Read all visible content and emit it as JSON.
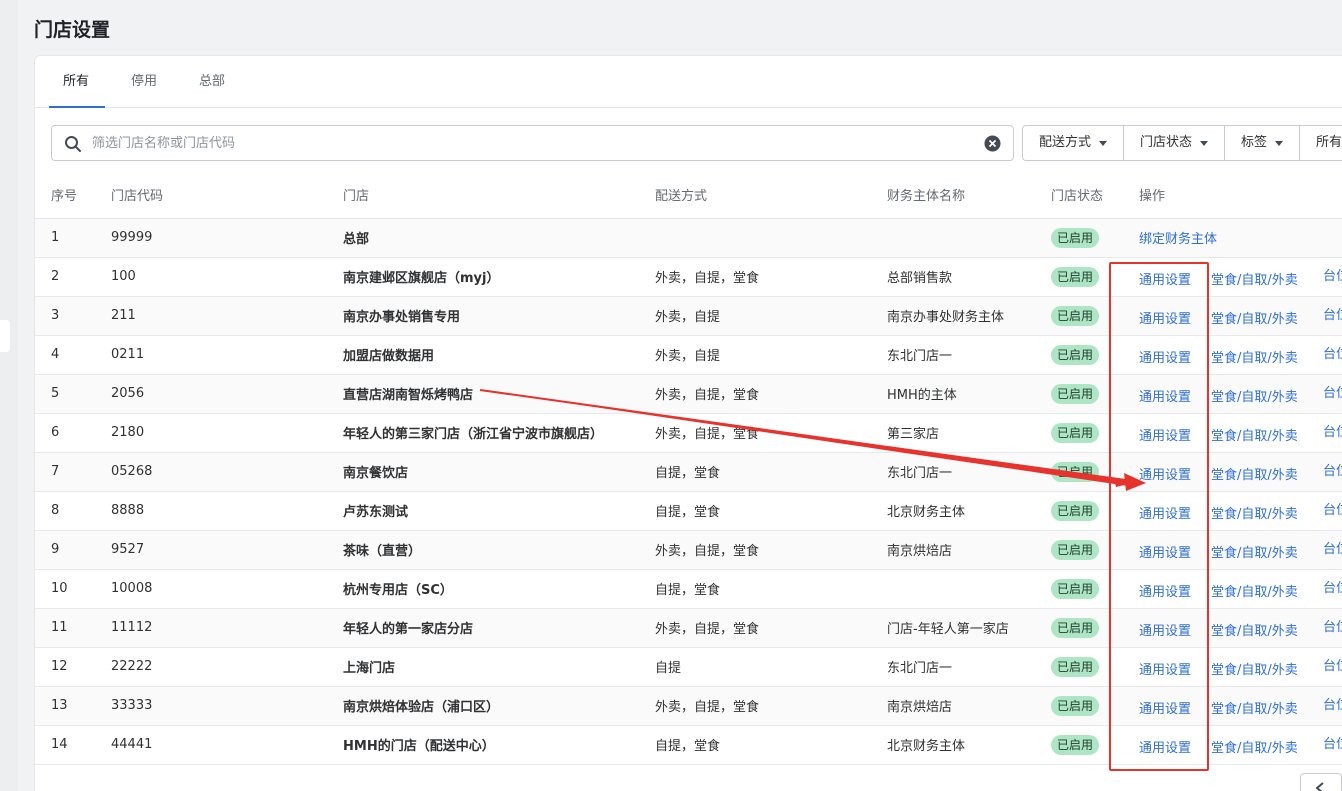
{
  "page": {
    "title": "门店设置"
  },
  "tabs": [
    {
      "label": "所有",
      "active": true
    },
    {
      "label": "停用",
      "active": false
    },
    {
      "label": "总部",
      "active": false
    }
  ],
  "search": {
    "placeholder": "筛选门店名称或门店代码",
    "value": ""
  },
  "filters": [
    {
      "label": "配送方式"
    },
    {
      "label": "门店状态"
    },
    {
      "label": "标签"
    },
    {
      "label": "所有"
    }
  ],
  "table": {
    "headers": {
      "index": "序号",
      "code": "门店代码",
      "store": "门店",
      "delivery": "配送方式",
      "finance": "财务主体名称",
      "status": "门店状态",
      "ops": "操作"
    },
    "rows": [
      {
        "index": "1",
        "code": "99999",
        "store": "总部",
        "delivery": "",
        "finance": "",
        "status": "已启用",
        "op1": "绑定财务主体",
        "op2": "",
        "op3": ""
      },
      {
        "index": "2",
        "code": "100",
        "store": "南京建邺区旗舰店（myj）",
        "delivery": "外卖，自提，堂食",
        "finance": "总部销售款",
        "status": "已启用",
        "op1": "通用设置",
        "op2": "堂食/自取/外卖",
        "op3": "台位"
      },
      {
        "index": "3",
        "code": "211",
        "store": "南京办事处销售专用",
        "delivery": "外卖，自提",
        "finance": "南京办事处财务主体",
        "status": "已启用",
        "op1": "通用设置",
        "op2": "堂食/自取/外卖",
        "op3": "台位"
      },
      {
        "index": "4",
        "code": "0211",
        "store": "加盟店做数据用",
        "delivery": "外卖，自提",
        "finance": "东北门店一",
        "status": "已启用",
        "op1": "通用设置",
        "op2": "堂食/自取/外卖",
        "op3": "台位"
      },
      {
        "index": "5",
        "code": "2056",
        "store": "直营店湖南智烁烤鸭店",
        "delivery": "外卖，自提，堂食",
        "finance": "HMH的主体",
        "status": "已启用",
        "op1": "通用设置",
        "op2": "堂食/自取/外卖",
        "op3": "台位"
      },
      {
        "index": "6",
        "code": "2180",
        "store": "年轻人的第三家门店（浙江省宁波市旗舰店）",
        "delivery": "外卖，自提，堂食",
        "finance": "第三家店",
        "status": "已启用",
        "op1": "通用设置",
        "op2": "堂食/自取/外卖",
        "op3": "台位"
      },
      {
        "index": "7",
        "code": "05268",
        "store": "南京餐饮店",
        "delivery": "自提，堂食",
        "finance": "东北门店一",
        "status": "已启用",
        "op1": "通用设置",
        "op2": "堂食/自取/外卖",
        "op3": "台位"
      },
      {
        "index": "8",
        "code": "8888",
        "store": "卢苏东测试",
        "delivery": "自提，堂食",
        "finance": "北京财务主体",
        "status": "已启用",
        "op1": "通用设置",
        "op2": "堂食/自取/外卖",
        "op3": "台位"
      },
      {
        "index": "9",
        "code": "9527",
        "store": "茶味（直营）",
        "delivery": "外卖，自提，堂食",
        "finance": "南京烘焙店",
        "status": "已启用",
        "op1": "通用设置",
        "op2": "堂食/自取/外卖",
        "op3": "台位"
      },
      {
        "index": "10",
        "code": "10008",
        "store": "杭州专用店（SC）",
        "delivery": "自提，堂食",
        "finance": "",
        "status": "已启用",
        "op1": "通用设置",
        "op2": "堂食/自取/外卖",
        "op3": "台位"
      },
      {
        "index": "11",
        "code": "11112",
        "store": "年轻人的第一家店分店",
        "delivery": "外卖，自提，堂食",
        "finance": "门店-年轻人第一家店",
        "status": "已启用",
        "op1": "通用设置",
        "op2": "堂食/自取/外卖",
        "op3": "台位"
      },
      {
        "index": "12",
        "code": "22222",
        "store": "上海门店",
        "delivery": "自提",
        "finance": "东北门店一",
        "status": "已启用",
        "op1": "通用设置",
        "op2": "堂食/自取/外卖",
        "op3": "台位"
      },
      {
        "index": "13",
        "code": "33333",
        "store": "南京烘焙体验店（浦口区）",
        "delivery": "外卖，自提，堂食",
        "finance": "南京烘焙店",
        "status": "已启用",
        "op1": "通用设置",
        "op2": "堂食/自取/外卖",
        "op3": "台位"
      },
      {
        "index": "14",
        "code": "44441",
        "store": "HMH的门店（配送中心）",
        "delivery": "自提，堂食",
        "finance": "北京财务主体",
        "status": "已启用",
        "op1": "通用设置",
        "op2": "堂食/自取/外卖",
        "op3": "台位"
      }
    ]
  },
  "colors": {
    "accent": "#2f6fd6",
    "badge_bg": "#aee6c5",
    "annotation": "#e8322c"
  },
  "icons": {
    "search": "search-icon",
    "clear": "clear-icon",
    "caret": "chevron-down-icon",
    "pager": "chevron-left-icon"
  }
}
